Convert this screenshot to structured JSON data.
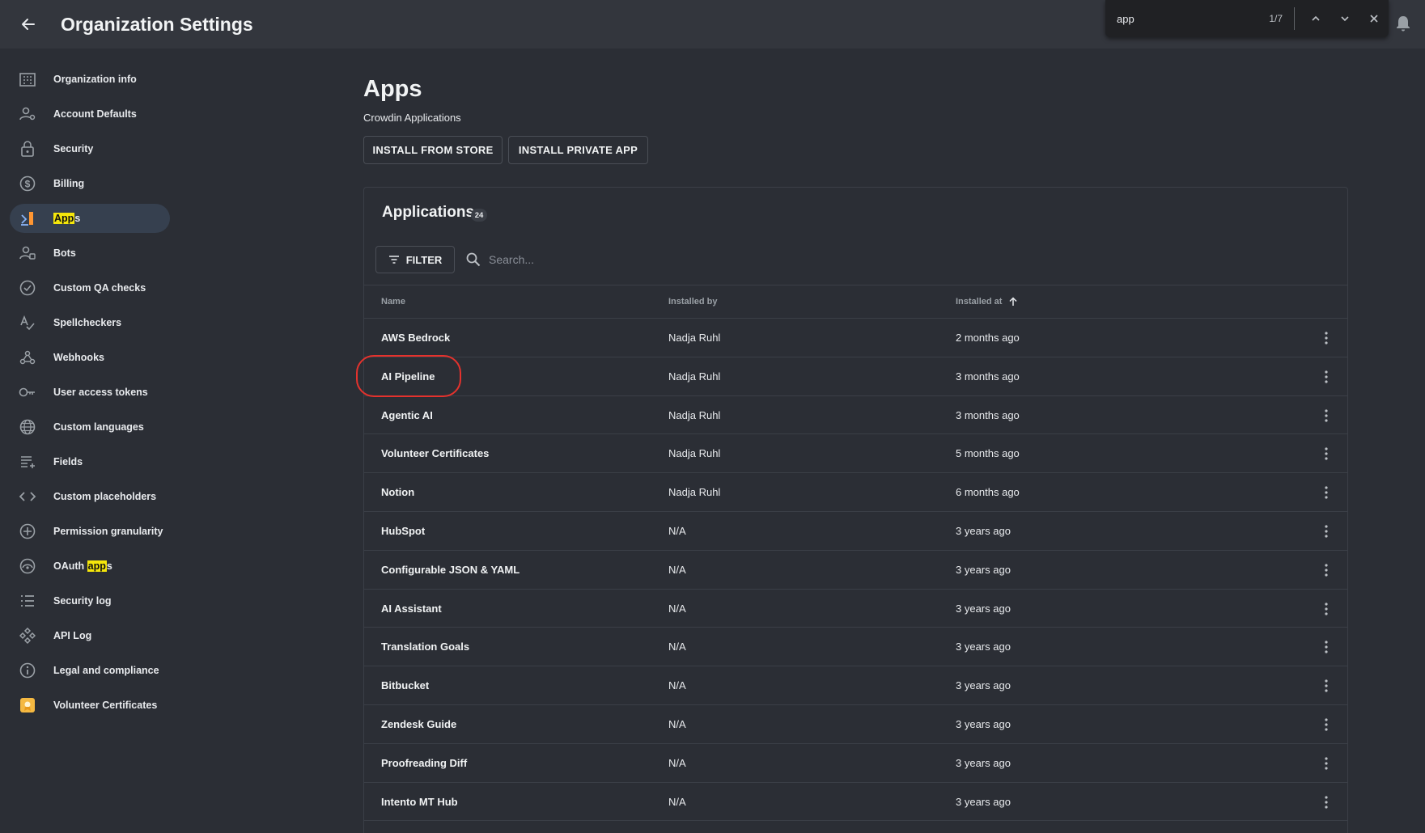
{
  "header": {
    "title": "Organization Settings",
    "back_icon": "arrow-left-icon",
    "bell_icon": "bell-icon"
  },
  "find_bar": {
    "query": "app",
    "count": "1/7"
  },
  "sidebar": {
    "items": [
      {
        "label": "Organization info",
        "icon": "building-icon"
      },
      {
        "label": "Account Defaults",
        "icon": "user-settings-icon"
      },
      {
        "label": "Security",
        "icon": "lock-icon"
      },
      {
        "label": "Billing",
        "icon": "dollar-circle-icon"
      },
      {
        "label_hl": "App",
        "label_rest": "s",
        "icon": "apps-icon",
        "active": true
      },
      {
        "label": "Bots",
        "icon": "bot-icon"
      },
      {
        "label": "Custom QA checks",
        "icon": "check-circle-icon"
      },
      {
        "label": "Spellcheckers",
        "icon": "spellcheck-icon"
      },
      {
        "label": "Webhooks",
        "icon": "webhook-icon"
      },
      {
        "label": "User access tokens",
        "icon": "key-icon"
      },
      {
        "label": "Custom languages",
        "icon": "globe-icon"
      },
      {
        "label": "Fields",
        "icon": "fields-icon"
      },
      {
        "label": "Custom placeholders",
        "icon": "code-icon"
      },
      {
        "label": "Permission granularity",
        "icon": "plus-circle-icon"
      },
      {
        "label_pre": "OAuth ",
        "label_hl": "app",
        "label_rest": "s",
        "icon": "oauth-icon"
      },
      {
        "label": "Security log",
        "icon": "list-icon"
      },
      {
        "label": "API Log",
        "icon": "api-icon"
      },
      {
        "label": "Legal and compliance",
        "icon": "info-icon"
      },
      {
        "label": "Volunteer Certificates",
        "icon": "certificate-icon"
      }
    ]
  },
  "main": {
    "title": "Apps",
    "subtitle": "Crowdin Applications",
    "install_store_label": "INSTALL FROM STORE",
    "install_private_label": "INSTALL PRIVATE APP"
  },
  "applications": {
    "title": "Applications",
    "count": "24",
    "filter_label": "FILTER",
    "search_placeholder": "Search...",
    "columns": {
      "name": "Name",
      "installed_by": "Installed by",
      "installed_at": "Installed at"
    },
    "rows": [
      {
        "name": "AWS Bedrock",
        "installed_by": "Nadja Ruhl",
        "installed_at": "2 months ago"
      },
      {
        "name": "AI Pipeline",
        "installed_by": "Nadja Ruhl",
        "installed_at": "3 months ago"
      },
      {
        "name": "Agentic AI",
        "installed_by": "Nadja Ruhl",
        "installed_at": "3 months ago"
      },
      {
        "name": "Volunteer Certificates",
        "installed_by": "Nadja Ruhl",
        "installed_at": "5 months ago"
      },
      {
        "name": "Notion",
        "installed_by": "Nadja Ruhl",
        "installed_at": "6 months ago"
      },
      {
        "name": "HubSpot",
        "installed_by": "N/A",
        "installed_at": "3 years ago"
      },
      {
        "name": "Configurable JSON & YAML",
        "installed_by": "N/A",
        "installed_at": "3 years ago"
      },
      {
        "name": "AI Assistant",
        "installed_by": "N/A",
        "installed_at": "3 years ago"
      },
      {
        "name": "Translation Goals",
        "installed_by": "N/A",
        "installed_at": "3 years ago"
      },
      {
        "name": "Bitbucket",
        "installed_by": "N/A",
        "installed_at": "3 years ago"
      },
      {
        "name": "Zendesk Guide",
        "installed_by": "N/A",
        "installed_at": "3 years ago"
      },
      {
        "name": "Proofreading Diff",
        "installed_by": "N/A",
        "installed_at": "3 years ago"
      },
      {
        "name": "Intento MT Hub",
        "installed_by": "N/A",
        "installed_at": "3 years ago"
      }
    ]
  },
  "colors": {
    "background": "#2b2e35",
    "topbar": "#33363d",
    "active_item": "#36404f",
    "highlight": "#f5e60b",
    "highlight_current": "#ff9632",
    "annotation": "#e5322d"
  }
}
